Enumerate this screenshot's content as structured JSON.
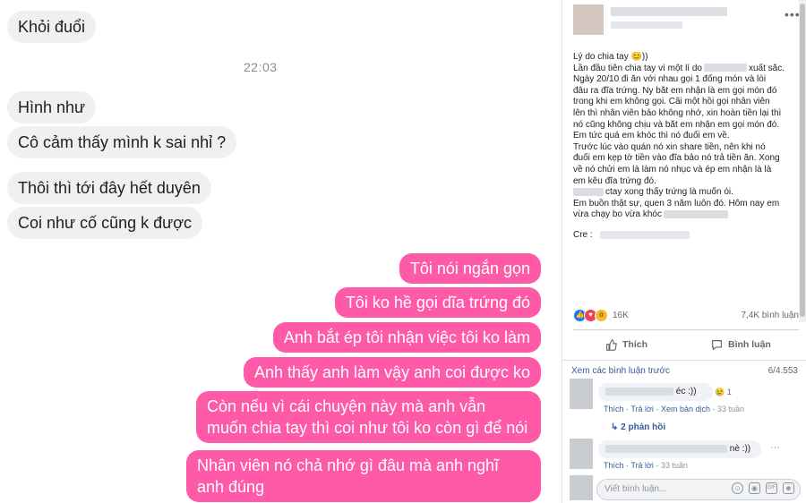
{
  "chat": {
    "timestamp": "22:03",
    "messages": [
      {
        "from": "them",
        "text": "Khỏi đuổi"
      },
      {
        "from": "them",
        "text": "Hình như"
      },
      {
        "from": "them",
        "text": "Cô cảm thấy mình k sai nhỉ ?"
      },
      {
        "from": "them",
        "text": "Thôi thì tới đây hết duyên"
      },
      {
        "from": "them",
        "text": "Coi như cố cũng k được"
      },
      {
        "from": "me",
        "text": "Tôi nói ngắn gọn"
      },
      {
        "from": "me",
        "text": "Tôi ko hề gọi dĩa trứng đó"
      },
      {
        "from": "me",
        "text": "Anh bắt ép tôi nhận việc tôi ko làm"
      },
      {
        "from": "me",
        "text": "Anh thấy anh làm vậy anh coi được ko"
      },
      {
        "from": "me",
        "text": "Còn nếu vì cái chuyện này mà anh vẫn muốn chia tay thì coi như tôi ko còn gì để nói"
      },
      {
        "from": "me",
        "text": "Nhân viên nó chả nhớ gì đâu mà anh nghĩ anh đúng"
      }
    ]
  },
  "post": {
    "more_icon": "•••",
    "lines": [
      "Lý do chia tay 😊))",
      "Lần đầu tiên chia tay vì một lí do",
      "xuất sắc.",
      "Ngày 20/10 đi ăn với nhau gọi 1 đống món và lòi",
      "đâu ra đĩa trứng. Ny bắt em nhận là em gọi món đó",
      "trong khi em không gọi. Cãi một hồi gọi nhân viên",
      "lên thì nhân viên bảo không nhớ, xin hoàn tiền lại thì",
      "nó cũng không chịu và bắt em nhận em gọi món đó.",
      "Em tức quá em khóc thì nó đuổi em về.",
      "Trước lúc vào quán nó xin share tiền, nên khi nó",
      "đuổi em kẹp tờ tiền vào đĩa bảo nó trả tiền ăn. Xong",
      "về nó chửi em là làm nó nhục và ép em nhận là là",
      "em kêu đĩa trứng đó.",
      "ctay xong thấy trứng là muốn ói.",
      "Em buồn thật sự, quen 3 năm luôn đó. Hôm nay em",
      "vừa chạy bo vừa khóc",
      "Cre :"
    ],
    "reactions": {
      "count": "16K",
      "comments": "7,4K bình luận"
    },
    "actions": {
      "like": "Thích",
      "comment": "Bình luận"
    },
    "comments": {
      "prev_link": "Xem các bình luận trước",
      "page_count": "6/4.553",
      "c1_text": "éc :))",
      "c1_reaction": "1",
      "c1_like": "Thích",
      "c1_reply": "Trả lời",
      "c1_translate": "Xem bản dịch",
      "c1_time": "33 tuần",
      "replies": "2 phản hồi",
      "c2_text": "nè :))",
      "c2_like": "Thích",
      "c2_reply": "Trả lời",
      "c2_time": "33 tuần",
      "input_placeholder": "Viết bình luận..."
    }
  },
  "colors": {
    "sent_bubble": "#ff5aa7",
    "received_bubble": "#f0f0f0",
    "link": "#385898"
  }
}
